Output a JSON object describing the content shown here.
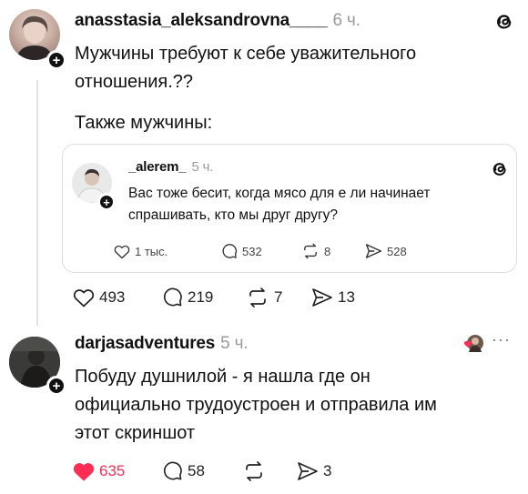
{
  "post1": {
    "username": "anasstasia_aleksandrovna____",
    "time": "6 ч.",
    "text_line1": "Мужчины требуют к себе уважительного",
    "text_line2": "отношения.??",
    "text_line3": "Также мужчины:",
    "actions": {
      "likes": "493",
      "comments": "219",
      "reposts": "7",
      "shares": "13"
    }
  },
  "quote": {
    "username": "_alerem_",
    "time": "5 ч.",
    "text_line1": "Вас тоже бесит, когда мясо для е   ли начинает",
    "text_line2": "спрашивать, кто мы друг другу?",
    "actions": {
      "likes": "1 тыс.",
      "comments": "532",
      "reposts": "8",
      "shares": "528"
    }
  },
  "post2": {
    "username": "darjasadventures",
    "time": "5 ч.",
    "text_line1": "Побуду душнилой - я нашла где он",
    "text_line2": "официально трудоустроен и отправила им",
    "text_line3": "этот скриншот",
    "actions": {
      "likes": "635",
      "comments": "58",
      "reposts": "",
      "shares": "3"
    }
  },
  "colors": {
    "like_red": "#ff2d55",
    "muted": "#9a9a9a"
  }
}
